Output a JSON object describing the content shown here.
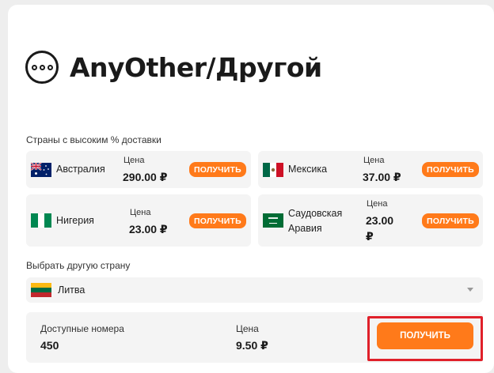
{
  "header": {
    "title": "AnyOther/Другой"
  },
  "high_delivery": {
    "label": "Страны с высоким % доставки",
    "items": [
      {
        "country": "Австралия",
        "price_label": "Цена",
        "price": "290.00 ₽",
        "button": "ПОЛУЧИТЬ",
        "flag_icon": "australia-flag-icon"
      },
      {
        "country": "Мексика",
        "price_label": "Цена",
        "price": "37.00 ₽",
        "button": "ПОЛУЧИТЬ",
        "flag_icon": "mexico-flag-icon"
      },
      {
        "country": "Нигерия",
        "price_label": "Цена",
        "price": "23.00 ₽",
        "button": "ПОЛУЧИТЬ",
        "flag_icon": "nigeria-flag-icon"
      },
      {
        "country_line1": "Саудовская",
        "country_line2": "Аравия",
        "price_label": "Цена",
        "price_line1": "23.00",
        "price_line2": "₽",
        "button": "ПОЛУЧИТЬ",
        "flag_icon": "saudi-arabia-flag-icon"
      }
    ]
  },
  "other_country": {
    "label": "Выбрать другую страну",
    "selected": "Литва",
    "flag_icon": "lithuania-flag-icon"
  },
  "summary": {
    "available_label": "Доступные номера",
    "available_value": "450",
    "price_label": "Цена",
    "price_value": "9.50 ₽",
    "button": "ПОЛУЧИТЬ"
  },
  "colors": {
    "accent": "#ff7a1a",
    "highlight": "#e0202a",
    "tile_bg": "#f4f4f4"
  }
}
